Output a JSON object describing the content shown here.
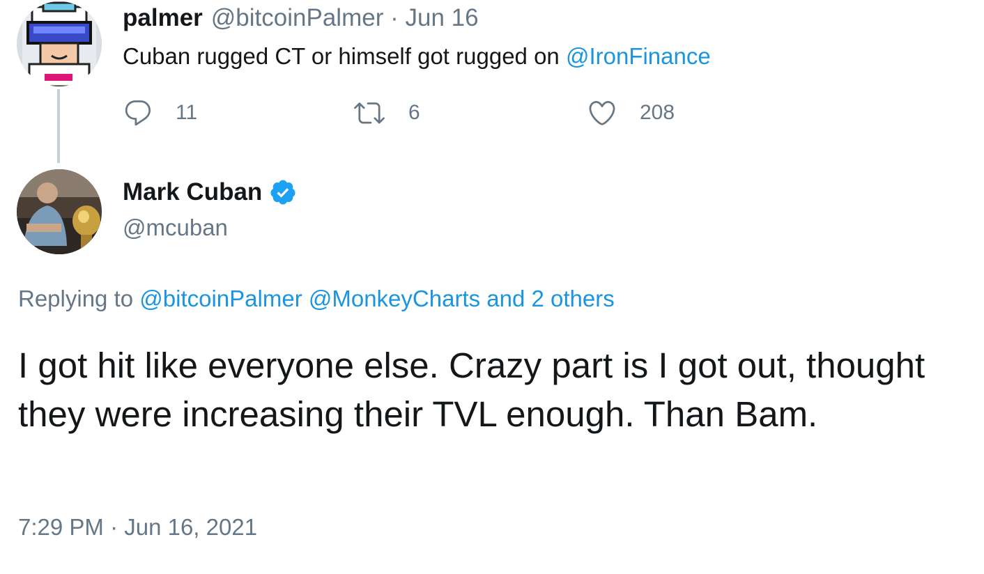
{
  "parent_tweet": {
    "display_name": "palmer",
    "handle": "@bitcoinPalmer",
    "separator": "·",
    "date": "Jun 16",
    "text_before_mention": "Cuban rugged CT or himself got rugged on ",
    "mention": "@IronFinance",
    "reply_count": "11",
    "retweet_count": "6",
    "like_count": "208",
    "icons": [
      "reply-icon",
      "retweet-icon",
      "like-icon"
    ]
  },
  "main_tweet": {
    "display_name": "Mark Cuban",
    "verified": true,
    "handle": "@mcuban",
    "replying_prefix": "Replying to ",
    "replying_mention_1": "@bitcoinPalmer",
    "replying_mention_2": "@MonkeyCharts",
    "replying_others": " and 2 others",
    "text": "I got hit like everyone else. Crazy part is I got out, thought they were increasing their TVL enough. Than Bam.",
    "timestamp": "7:29 PM · Jun 16, 2021"
  },
  "colors": {
    "link": "#1b95e0",
    "muted": "#657786",
    "text": "#14171a",
    "verified": "#1da1f2",
    "thread_line": "#c4cfd6"
  }
}
